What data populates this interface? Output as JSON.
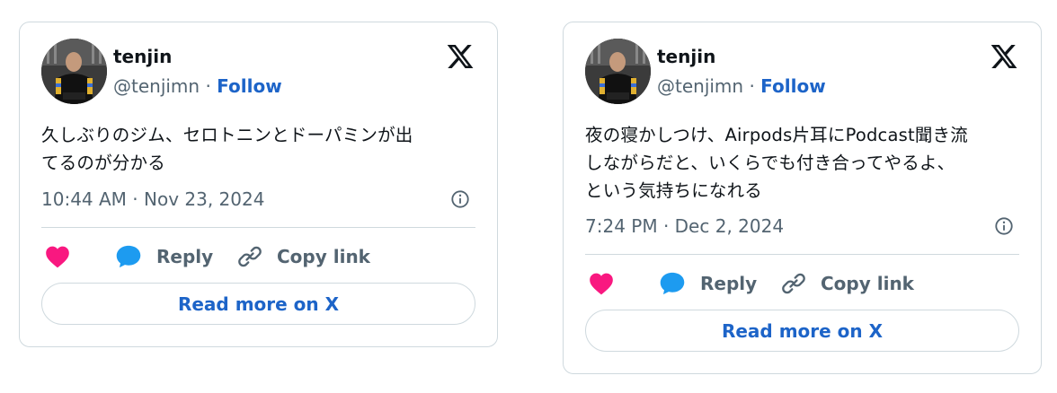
{
  "colors": {
    "card_border": "#cfd9de",
    "text_primary": "#0f1419",
    "text_secondary": "#536471",
    "link_blue": "#1d64c8",
    "heart_pink": "#f91880",
    "reply_blue": "#1d9bf0"
  },
  "tweets": [
    {
      "author": {
        "name": "tenjin",
        "handle": "@tenjimn",
        "follow_label": "Follow",
        "separator": " · "
      },
      "text": "久しぶりのジム、セロトニンとドーパミンが出\nてるのが分かる",
      "timestamp": "10:44 AM · Nov 23, 2024",
      "actions": {
        "reply_label": "Reply",
        "copy_label": "Copy link"
      },
      "read_more_label": "Read more on X",
      "icons": [
        "x-logo-icon",
        "info-icon",
        "heart-icon",
        "reply-bubble-icon",
        "link-icon"
      ]
    },
    {
      "author": {
        "name": "tenjin",
        "handle": "@tenjimn",
        "follow_label": "Follow",
        "separator": " · "
      },
      "text": "夜の寝かしつけ、Airpods片耳にPodcast聞き流\nしながらだと、いくらでも付き合ってやるよ、\nという気持ちになれる",
      "timestamp": "7:24 PM · Dec 2, 2024",
      "actions": {
        "reply_label": "Reply",
        "copy_label": "Copy link"
      },
      "read_more_label": "Read more on X",
      "icons": [
        "x-logo-icon",
        "info-icon",
        "heart-icon",
        "reply-bubble-icon",
        "link-icon"
      ]
    }
  ]
}
